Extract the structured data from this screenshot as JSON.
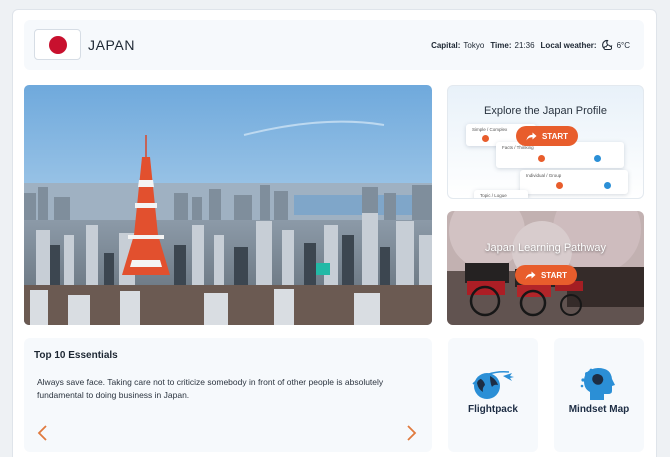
{
  "header": {
    "country": "JAPAN",
    "flag_color": "#c8102e",
    "capital_label": "Capital:",
    "capital_value": "Tokyo",
    "time_label": "Time:",
    "time_value": "21:36",
    "weather_label": "Local weather:",
    "weather_icon": "moon-cloud-icon",
    "weather_value": "6°C"
  },
  "hero": {
    "image": "tokyo-tower-cityscape-photo"
  },
  "profile_card": {
    "title": "Explore the Japan Profile",
    "start_label": "START",
    "preview_rows": [
      "Simple / Complex",
      "Facts / Thinking",
      "Individual / Group",
      "Topic / Logue"
    ]
  },
  "pathway_card": {
    "title": "Japan Learning Pathway",
    "start_label": "START"
  },
  "essentials": {
    "title": "Top 10 Essentials",
    "text": "Always save face. Taking care not to criticize somebody in front of other people is absolutely fundamental to doing business in Japan.",
    "prev_icon": "chevron-left-icon",
    "next_icon": "chevron-right-icon"
  },
  "tiles": {
    "flightpack": {
      "label": "Flightpack",
      "icon": "globe-plane-icon"
    },
    "mindset": {
      "label": "Mindset Map",
      "icon": "head-brain-icon"
    }
  },
  "colors": {
    "accent": "#e85d2c",
    "navy": "#1d2d44",
    "icon_blue": "#2b8fd6"
  }
}
